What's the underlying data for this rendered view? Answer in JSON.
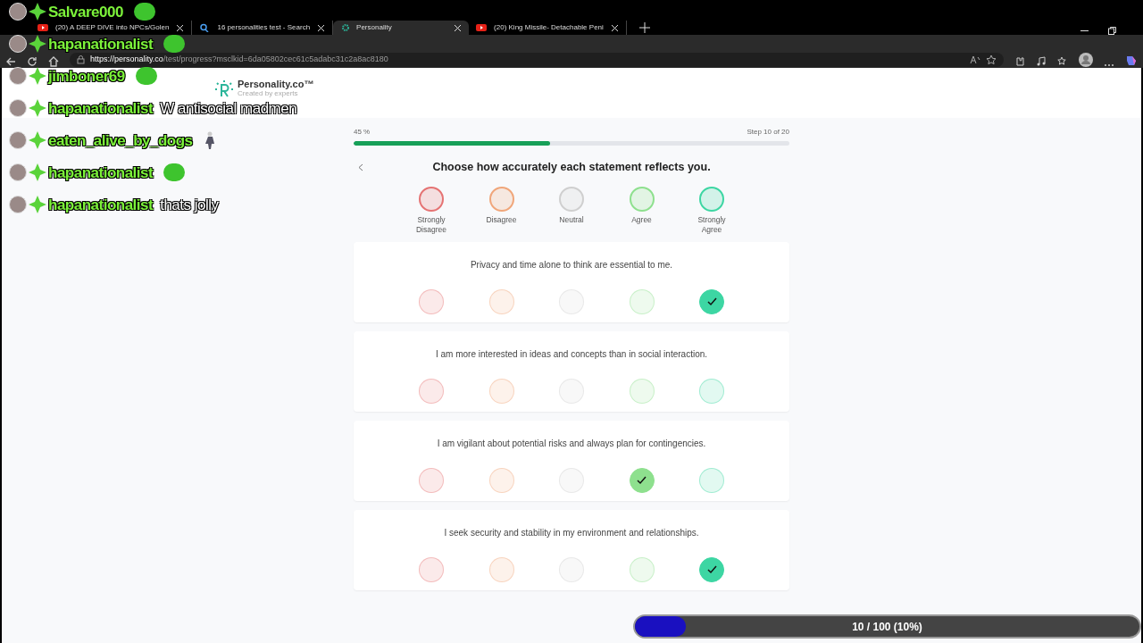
{
  "browser": {
    "tabs": [
      {
        "title": "(20) A DEEP DIVE into NPCs/Golen",
        "kind": "video",
        "selected": false
      },
      {
        "title": "16 personalities test - Search",
        "kind": "search",
        "selected": false
      },
      {
        "title": "Personality",
        "kind": "site",
        "selected": true
      },
      {
        "title": "(20) King Missile- Detachable Peni",
        "kind": "video",
        "selected": false
      }
    ],
    "url_host": "https://personality.co",
    "url_rest": "/test/progress?msclkid=6da05802cec61c5adabc31c2a8ac8180"
  },
  "page": {
    "logo": {
      "name": "Personality.co™",
      "tagline": "Created by experts"
    },
    "progress": {
      "percent": "45 %",
      "level": 0.45,
      "step": "Step 10 of 20"
    },
    "heading": "Choose how accurately each statement reflects you.",
    "scale": [
      {
        "label": "Strongly Disagree",
        "color": "#e57373"
      },
      {
        "label": "Disagree",
        "color": "#f0a67a"
      },
      {
        "label": "Neutral",
        "color": "#cfcfcf"
      },
      {
        "label": "Agree",
        "color": "#8ee08e"
      },
      {
        "label": "Strongly Agree",
        "color": "#3dd6a3"
      }
    ],
    "questions": [
      {
        "text": "Privacy and time alone to think are essential to me.",
        "answers": [
          {
            "selected": false
          },
          {
            "selected": false
          },
          {
            "selected": false
          },
          {
            "selected": false
          },
          {
            "selected": true
          }
        ]
      },
      {
        "text": "I am more interested in ideas and concepts than in social interaction.",
        "answers": [
          {
            "selected": false
          },
          {
            "selected": false
          },
          {
            "selected": false
          },
          {
            "selected": false
          },
          {
            "selected": false
          }
        ]
      },
      {
        "text": "I am vigilant about potential risks and always plan for contingencies.",
        "answers": [
          {
            "selected": false
          },
          {
            "selected": false
          },
          {
            "selected": false
          },
          {
            "selected": true
          },
          {
            "selected": false
          }
        ]
      },
      {
        "text": "I seek security and stability in my environment and relationships.",
        "answers": [
          {
            "selected": false
          },
          {
            "selected": false
          },
          {
            "selected": false
          },
          {
            "selected": false
          },
          {
            "selected": true
          }
        ]
      }
    ]
  },
  "chat_overlay": [
    {
      "user": "Salvare000",
      "kind": "emote"
    },
    {
      "user": "hapanationalist",
      "kind": "emote"
    },
    {
      "user": "jimboner69",
      "kind": "emote"
    },
    {
      "user": "hapanationalist",
      "kind": "text",
      "text": "W antisocial madmen"
    },
    {
      "user": "eaten_alive_by_dogs",
      "kind": "figure"
    },
    {
      "user": "hapanationalist",
      "kind": "emote"
    },
    {
      "user": "hapanationalist",
      "kind": "text",
      "text": "thats jolly"
    }
  ],
  "goal_bar": {
    "text": "10 / 100 (10%)",
    "level": 0.1
  }
}
